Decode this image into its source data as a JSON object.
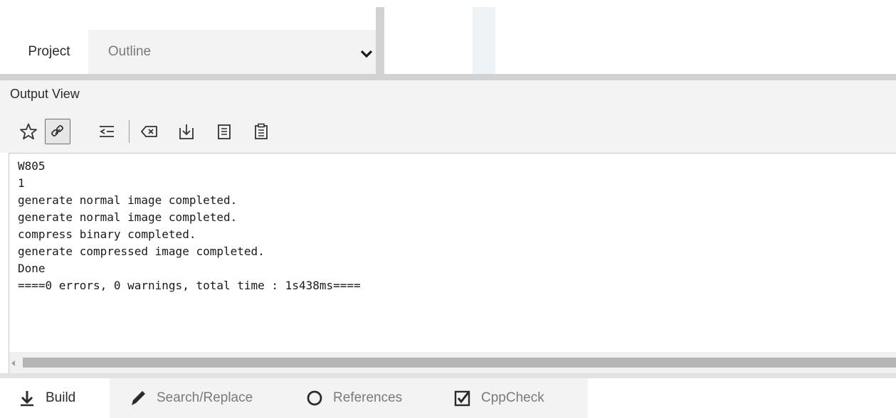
{
  "top_tabs": [
    {
      "label": "Project",
      "active": true
    },
    {
      "label": "Outline",
      "active": false
    }
  ],
  "top_dropdown": {
    "icon": "chevron-down-icon"
  },
  "output_view": {
    "title": "Output View",
    "toolbar": [
      {
        "name": "star-icon",
        "active": false
      },
      {
        "name": "link-icon",
        "active": true
      },
      {
        "name": "wrap-lines-icon",
        "active": false
      },
      {
        "name": "clear-icon",
        "active": false
      },
      {
        "name": "download-icon",
        "active": false
      },
      {
        "name": "copy-icon",
        "active": false
      },
      {
        "name": "paste-icon",
        "active": false
      }
    ],
    "lines": [
      "W805",
      "1",
      "generate normal image completed.",
      "generate normal image completed.",
      "compress binary completed.",
      "generate compressed image completed.",
      "Done",
      "====0 errors, 0 warnings, total time : 1s438ms===="
    ]
  },
  "bottom_tabs": [
    {
      "label": "Build",
      "icon": "download-arrow-icon",
      "active": true
    },
    {
      "label": "Search/Replace",
      "icon": "pencil-icon",
      "active": false
    },
    {
      "label": "References",
      "icon": "circle-icon",
      "active": false
    },
    {
      "label": "CppCheck",
      "icon": "checkbox-icon",
      "active": false
    }
  ],
  "colors": {
    "panel_bg": "#f3f3f3",
    "splitter": "#d2d2d2",
    "active_tab": "#ffffff",
    "inactive_text": "#7a7a7a"
  }
}
